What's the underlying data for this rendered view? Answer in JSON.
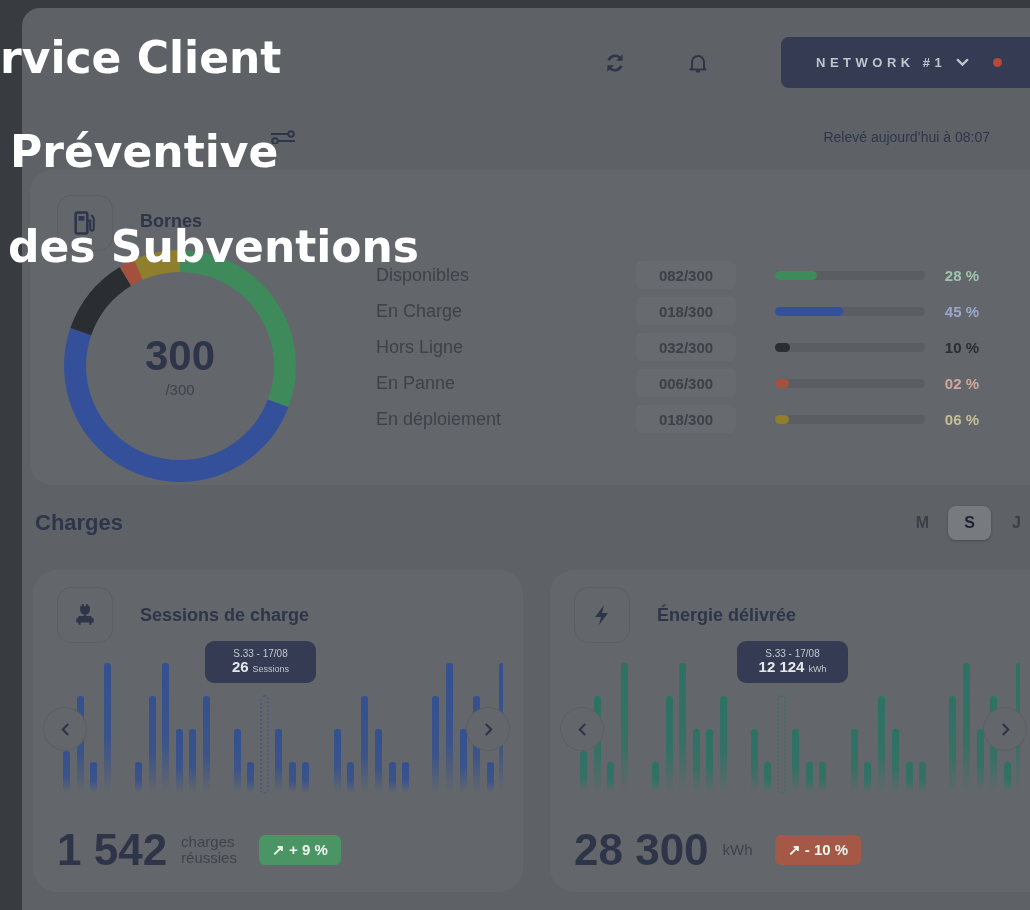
{
  "menu": [
    {
      "label": "rvice Client"
    },
    {
      "label": "Préventive"
    },
    {
      "label": "des Subventions"
    }
  ],
  "header": {
    "network": "NETWORK #1"
  },
  "dashboard": {
    "reading_time": "Relevé aujourd’hui à 08:07"
  },
  "bornes": {
    "title": "Bornes",
    "total": "300",
    "total_of": "/300",
    "rows": [
      {
        "label": "Disponibles",
        "count": "082/300",
        "level": 0.28,
        "percent": "28 %",
        "color": "#3f8a5a"
      },
      {
        "label": "En Charge",
        "count": "018/300",
        "level": 0.45,
        "percent": "45 %",
        "color": "#34509a"
      },
      {
        "label": "Hors Ligne",
        "count": "032/300",
        "level": 0.1,
        "percent": "10 %",
        "color": "#2a2d31"
      },
      {
        "label": "En Panne",
        "count": "006/300",
        "level": 0.02,
        "percent": "02 %",
        "color": "#a4503e"
      },
      {
        "label": "En déploiement",
        "count": "018/300",
        "level": 0.06,
        "percent": "06 %",
        "color": "#8f7f2c"
      }
    ]
  },
  "charges": {
    "title": "Charges",
    "periods": [
      {
        "label": "M",
        "selected": false
      },
      {
        "label": "S",
        "selected": true
      },
      {
        "label": "J",
        "selected": false
      }
    ],
    "cards": [
      {
        "kind": "sessions",
        "title": "Sessions de charge",
        "tooltip_date": "S.33 - 17/08",
        "tooltip_value": "26",
        "tooltip_unit": "Sessions",
        "total": "1 542",
        "unit": "charges réussies",
        "delta": "↗ + 9 %",
        "color": "#4a9563"
      },
      {
        "kind": "energy",
        "title": "Énergie délivrée",
        "tooltip_date": "S.33 - 17/08",
        "tooltip_value": "12 124",
        "tooltip_unit": "kWh",
        "total": "28 300",
        "unit": "kWh",
        "delta": "↗ - 10 %",
        "color": "#a65846"
      }
    ]
  }
}
